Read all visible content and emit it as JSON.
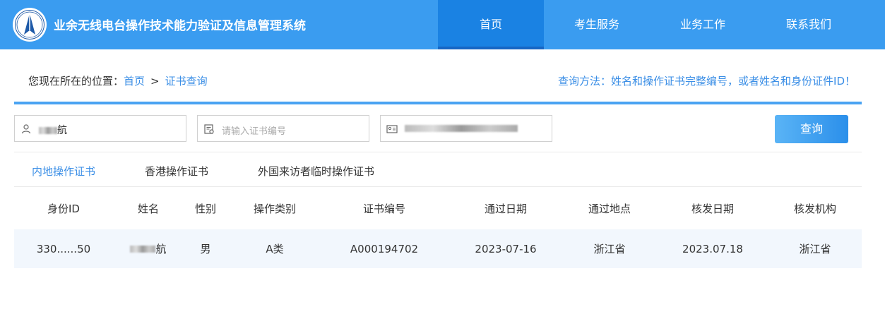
{
  "header": {
    "title": "业余无线电台操作技术能力验证及信息管理系统",
    "nav": [
      "首页",
      "考生服务",
      "业务工作",
      "联系我们"
    ],
    "active_nav": 0
  },
  "breadcrumb": {
    "prefix": "您现在所在的位置：",
    "home": "首页",
    "separator": ">",
    "current": "证书查询"
  },
  "hint": "查询方法：姓名和操作证书完整编号，或者姓名和身份证件ID！",
  "search": {
    "name_value_visible": "航",
    "cert_placeholder": "请输入证书编号",
    "button_label": "查询"
  },
  "tabs": [
    "内地操作证书",
    "香港操作证书",
    "外国来访者临时操作证书"
  ],
  "active_tab": 0,
  "table": {
    "columns": [
      "身份ID",
      "姓名",
      "性别",
      "操作类别",
      "证书编号",
      "通过日期",
      "通过地点",
      "核发日期",
      "核发机构"
    ],
    "rows": [
      {
        "id": "330......50",
        "name_visible": "航",
        "gender": "男",
        "category": "A类",
        "cert_no": "A000194702",
        "pass_date": "2023-07-16",
        "pass_place": "浙江省",
        "issue_date": "2023.07.18",
        "issuer": "浙江省"
      }
    ]
  },
  "colors": {
    "header_bg": "#3a9cf0",
    "nav_active_bg": "#1a82e3",
    "link": "#3a8ee6",
    "row_bg": "#f2f7fd"
  }
}
